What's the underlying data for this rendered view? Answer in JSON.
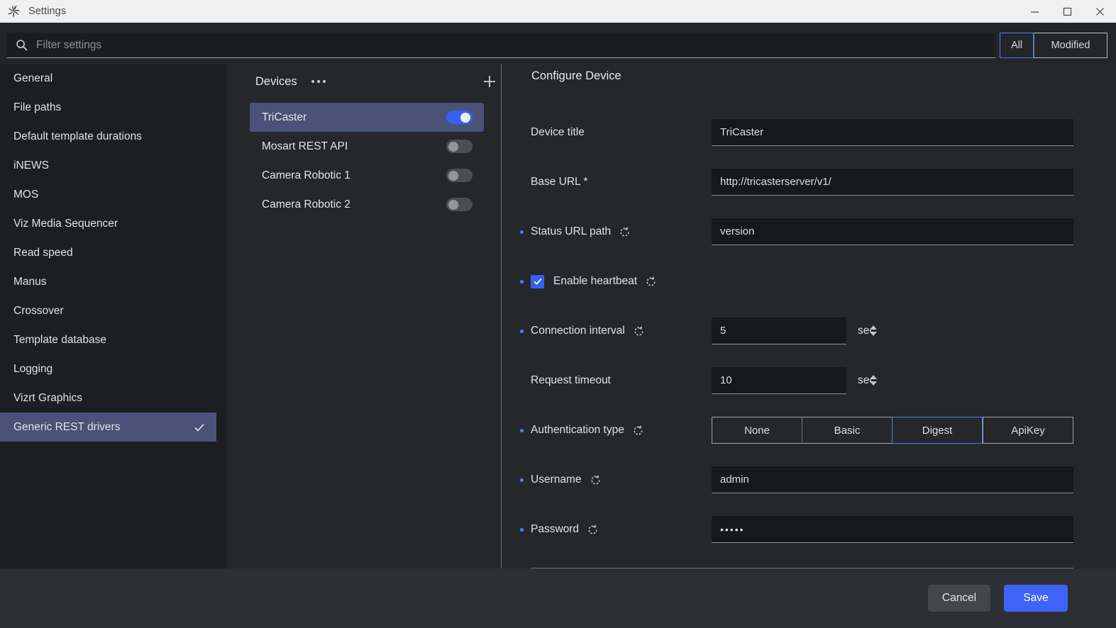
{
  "window": {
    "title": "Settings",
    "app_icon": "vizrt-pinwheel-icon",
    "minimize_label": "Minimize",
    "maximize_label": "Maximize",
    "close_label": "Close"
  },
  "search": {
    "placeholder": "Filter settings",
    "value": "",
    "icon": "search-icon"
  },
  "filter_toggle": {
    "options": [
      "All",
      "Modified"
    ],
    "selected": "All",
    "accent": "#4f7fe8"
  },
  "sidebar": {
    "items": [
      {
        "label": "General",
        "selected": false
      },
      {
        "label": "File paths",
        "selected": false
      },
      {
        "label": "Default template durations",
        "selected": false
      },
      {
        "label": "iNEWS",
        "selected": false
      },
      {
        "label": "MOS",
        "selected": false
      },
      {
        "label": "Viz Media Sequencer",
        "selected": false
      },
      {
        "label": "Read speed",
        "selected": false
      },
      {
        "label": "Manus",
        "selected": false
      },
      {
        "label": "Crossover",
        "selected": false
      },
      {
        "label": "Template database",
        "selected": false
      },
      {
        "label": "Logging",
        "selected": false
      },
      {
        "label": "Vizrt Graphics",
        "selected": false
      },
      {
        "label": "Generic REST drivers",
        "selected": true
      }
    ],
    "selected_bg": "#4b5279"
  },
  "devices_panel": {
    "title": "Devices",
    "more_label": "More options",
    "add_label": "Add device",
    "items": [
      {
        "name": "TriCaster",
        "enabled": true,
        "selected": true
      },
      {
        "name": "Mosart REST API",
        "enabled": false,
        "selected": false
      },
      {
        "name": "Camera Robotic 1",
        "enabled": false,
        "selected": false
      },
      {
        "name": "Camera Robotic 2",
        "enabled": false,
        "selected": false
      }
    ],
    "toggle_on_color": "#3561f0",
    "toggle_off_color": "#4a4f54"
  },
  "configure": {
    "title": "Configure Device",
    "fields": {
      "device_title": {
        "label": "Device title",
        "value": "TriCaster",
        "modified": false,
        "resettable": false
      },
      "base_url": {
        "label": "Base URL *",
        "value": "http://tricasterserver/v1/",
        "modified": false,
        "resettable": false
      },
      "status_url_path": {
        "label": "Status URL path",
        "value": "version",
        "modified": true,
        "resettable": true
      },
      "enable_heartbeat": {
        "label": "Enable heartbeat",
        "checked": true,
        "modified": true,
        "resettable": true
      },
      "connection_interval": {
        "label": "Connection interval",
        "value": "5",
        "unit": "sec",
        "modified": true,
        "resettable": true
      },
      "request_timeout": {
        "label": "Request timeout",
        "value": "10",
        "unit": "sec",
        "modified": false,
        "resettable": false
      },
      "authentication_type": {
        "label": "Authentication type",
        "options": [
          "None",
          "Basic",
          "Digest",
          "ApiKey"
        ],
        "selected": "Digest",
        "modified": true,
        "resettable": true
      },
      "username": {
        "label": "Username",
        "value": "admin",
        "modified": true,
        "resettable": true
      },
      "password": {
        "label": "Password",
        "value": "•••••",
        "modified": true,
        "resettable": true
      }
    },
    "reset_icon": "reset-circular-arrow-icon",
    "modified_marker_color": "#4f7fe8"
  },
  "footer": {
    "cancel_label": "Cancel",
    "save_label": "Save",
    "save_color": "#3f63f5"
  }
}
